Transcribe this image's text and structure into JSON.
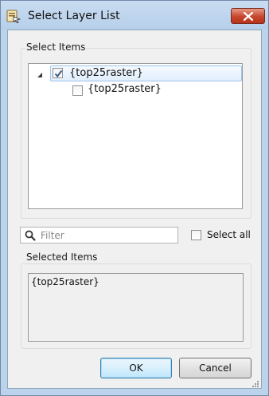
{
  "window": {
    "title": "Select Layer List",
    "icon": "layer-list-app-icon",
    "close_icon": "close-icon"
  },
  "select_items": {
    "group_label": "Select Items",
    "tree": [
      {
        "label": "{top25raster}",
        "checked": true,
        "expanded": true,
        "selected": true
      },
      {
        "label": "{top25raster}",
        "checked": false,
        "selected": false
      }
    ]
  },
  "filter": {
    "placeholder": "Filter",
    "value": "",
    "icon": "search-icon"
  },
  "select_all": {
    "label": "Select all",
    "checked": false
  },
  "selected_items": {
    "group_label": "Selected Items",
    "text": "{top25raster}"
  },
  "buttons": {
    "ok": "OK",
    "cancel": "Cancel"
  },
  "colors": {
    "frame": "#bcd3ec",
    "close_button": "#c7462c",
    "selection_highlight": "#e0eefc",
    "default_button_border": "#3c7fb1"
  }
}
